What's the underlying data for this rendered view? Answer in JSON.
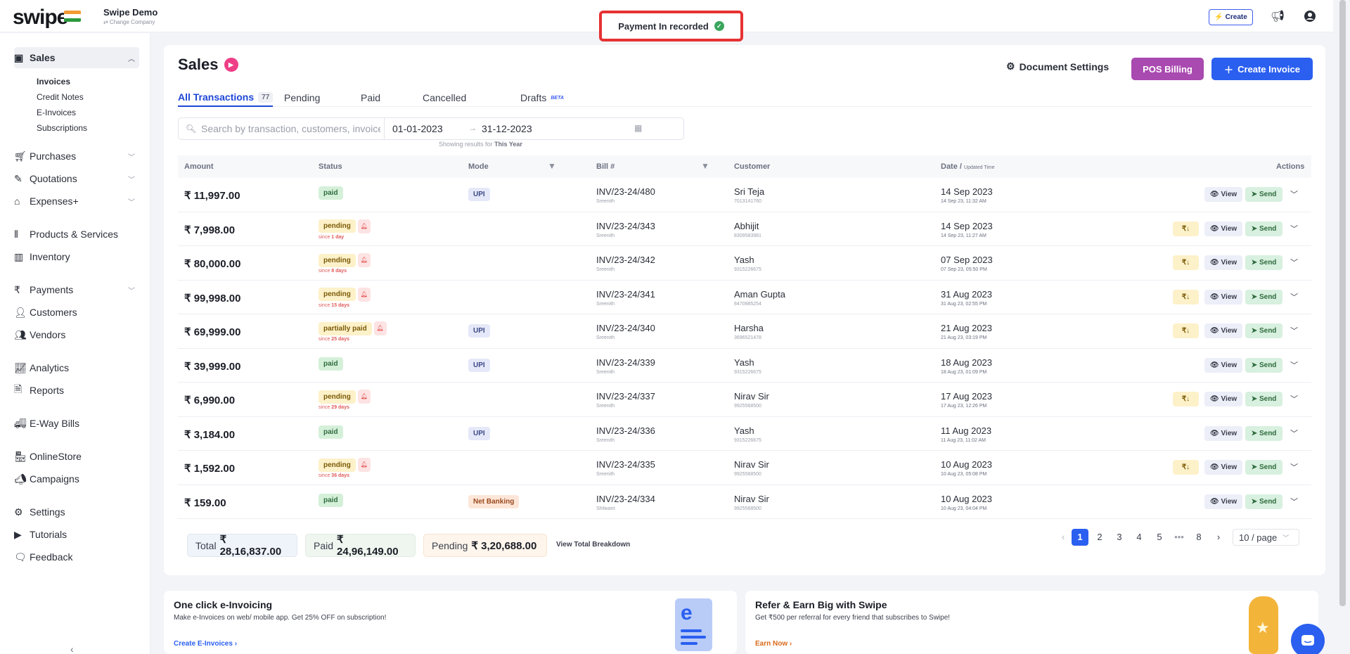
{
  "topbar": {
    "logo": "swipe",
    "company_name": "Swipe Demo",
    "change_company": "⇄ Change Company",
    "toast": "Payment In recorded",
    "create_label": "Create"
  },
  "sidebar": {
    "sales": "Sales",
    "sub_items": [
      "Invoices",
      "Credit Notes",
      "E-Invoices",
      "Subscriptions"
    ],
    "items": [
      {
        "label": "Purchases",
        "icon": "cart-icon"
      },
      {
        "label": "Quotations",
        "icon": "pencil-icon"
      },
      {
        "label": "Expenses+",
        "icon": "tag-icon"
      },
      {
        "label": "Products & Services",
        "icon": "barcode-icon"
      },
      {
        "label": "Inventory",
        "icon": "chart-icon"
      },
      {
        "label": "Payments",
        "icon": "rupee-icon"
      },
      {
        "label": "Customers",
        "icon": "user-icon"
      },
      {
        "label": "Vendors",
        "icon": "users-icon"
      },
      {
        "label": "Analytics",
        "icon": "analytics-icon"
      },
      {
        "label": "Reports",
        "icon": "report-icon"
      },
      {
        "label": "E-Way Bills",
        "icon": "truck-icon"
      },
      {
        "label": "OnlineStore",
        "icon": "store-icon"
      },
      {
        "label": "Campaigns",
        "icon": "megaphone-icon"
      },
      {
        "label": "Settings",
        "icon": "gear-icon"
      },
      {
        "label": "Tutorials",
        "icon": "youtube-icon"
      },
      {
        "label": "Feedback",
        "icon": "chat-icon"
      }
    ]
  },
  "main": {
    "title": "Sales",
    "document_settings": "Document Settings",
    "pos_billing": "POS Billing",
    "create_invoice": "Create Invoice",
    "tabs": {
      "all": "All Transactions",
      "all_count": "77",
      "pending": "Pending",
      "paid": "Paid",
      "cancelled": "Cancelled",
      "drafts": "Drafts",
      "beta": "BETA"
    },
    "search_placeholder": "Search by transaction, customers, invoice #...",
    "date_from": "01-01-2023",
    "date_to": "31-12-2023",
    "showing_prefix": "Showing results for",
    "showing_value": "This Year",
    "columns": {
      "amount": "Amount",
      "status": "Status",
      "mode": "Mode",
      "bill": "Bill #",
      "customer": "Customer",
      "date": "Date /",
      "date_sub": "Updated Time",
      "actions": "Actions"
    },
    "view_label": "View",
    "send_label": "Send",
    "rows": [
      {
        "amount": "₹ 11,997.00",
        "status": "paid",
        "since": "",
        "since_val": "",
        "mode": "UPI",
        "bill": "INV/23-24/480",
        "bill_by": "Sreenith",
        "customer": "Sri Teja",
        "phone": "7013141760",
        "date": "14 Sep 2023",
        "time": "14 Sep 23, 11:32 AM",
        "pay": false
      },
      {
        "amount": "₹ 7,998.00",
        "status": "pending",
        "since": "since",
        "since_val": "1 day",
        "mode": "",
        "bill": "INV/23-24/343",
        "bill_by": "Sreenith",
        "customer": "Abhijit",
        "phone": "8309583981",
        "date": "14 Sep 2023",
        "time": "14 Sep 23, 11:27 AM",
        "pay": true
      },
      {
        "amount": "₹ 80,000.00",
        "status": "pending",
        "since": "since",
        "since_val": "8 days",
        "mode": "",
        "bill": "INV/23-24/342",
        "bill_by": "Sreenith",
        "customer": "Yash",
        "phone": "9315226675",
        "date": "07 Sep 2023",
        "time": "07 Sep 23, 05:50 PM",
        "pay": true
      },
      {
        "amount": "₹ 99,998.00",
        "status": "pending",
        "since": "since",
        "since_val": "15 days",
        "mode": "",
        "bill": "INV/23-24/341",
        "bill_by": "Sreenith",
        "customer": "Aman Gupta",
        "phone": "8470885254",
        "date": "31 Aug 2023",
        "time": "31 Aug 23, 02:55 PM",
        "pay": true
      },
      {
        "amount": "₹ 69,999.00",
        "status": "partially paid",
        "since": "since",
        "since_val": "25 days",
        "mode": "UPI",
        "bill": "INV/23-24/340",
        "bill_by": "Sreenith",
        "customer": "Harsha",
        "phone": "3696521478",
        "date": "21 Aug 2023",
        "time": "21 Aug 23, 03:19 PM",
        "pay": true
      },
      {
        "amount": "₹ 39,999.00",
        "status": "paid",
        "since": "",
        "since_val": "",
        "mode": "UPI",
        "bill": "INV/23-24/339",
        "bill_by": "Sreenith",
        "customer": "Yash",
        "phone": "9315226675",
        "date": "18 Aug 2023",
        "time": "18 Aug 23, 01:09 PM",
        "pay": false
      },
      {
        "amount": "₹ 6,990.00",
        "status": "pending",
        "since": "since",
        "since_val": "29 days",
        "mode": "",
        "bill": "INV/23-24/337",
        "bill_by": "Sreenith",
        "customer": "Nirav Sir",
        "phone": "9925568500",
        "date": "17 Aug 2023",
        "time": "17 Aug 23, 12:26 PM",
        "pay": true
      },
      {
        "amount": "₹ 3,184.00",
        "status": "paid",
        "since": "",
        "since_val": "",
        "mode": "UPI",
        "bill": "INV/23-24/336",
        "bill_by": "Sreenith",
        "customer": "Yash",
        "phone": "9315226675",
        "date": "11 Aug 2023",
        "time": "11 Aug 23, 11:02 AM",
        "pay": false
      },
      {
        "amount": "₹ 1,592.00",
        "status": "pending",
        "since": "since",
        "since_val": "36 days",
        "mode": "",
        "bill": "INV/23-24/335",
        "bill_by": "Sreenith",
        "customer": "Nirav Sir",
        "phone": "9925568500",
        "date": "10 Aug 2023",
        "time": "10 Aug 23, 05:08 PM",
        "pay": true
      },
      {
        "amount": "₹ 159.00",
        "status": "paid",
        "since": "",
        "since_val": "",
        "mode": "Net Banking",
        "bill": "INV/23-24/334",
        "bill_by": "Shilwant",
        "customer": "Nirav Sir",
        "phone": "9925568500",
        "date": "10 Aug 2023",
        "time": "10 Aug 23, 04:04 PM",
        "pay": false
      }
    ],
    "totals": {
      "total_label": "Total",
      "total_value": "₹ 28,16,837.00",
      "paid_label": "Paid",
      "paid_value": "₹ 24,96,149.00",
      "pending_label": "Pending",
      "pending_value": "₹ 3,20,688.00",
      "breakdown": "View Total Breakdown"
    },
    "pagination": {
      "pages": [
        "1",
        "2",
        "3",
        "4",
        "5",
        "•••",
        "8"
      ],
      "active": "1",
      "per_page": "10 / page"
    }
  },
  "promos": [
    {
      "title": "One click e-Invoicing",
      "desc": "Make e-Invoices on web/ mobile app. Get 25% OFF on subscription!",
      "link": "Create E-Invoices ›"
    },
    {
      "title": "Refer & Earn Big with Swipe",
      "desc": "Get ₹500 per referral for every friend that subscribes to Swipe!",
      "link": "Earn Now ›"
    }
  ],
  "colors": {
    "primary": "#2a5ff0",
    "pos": "#a94ab0",
    "toast_border": "#e63232"
  }
}
